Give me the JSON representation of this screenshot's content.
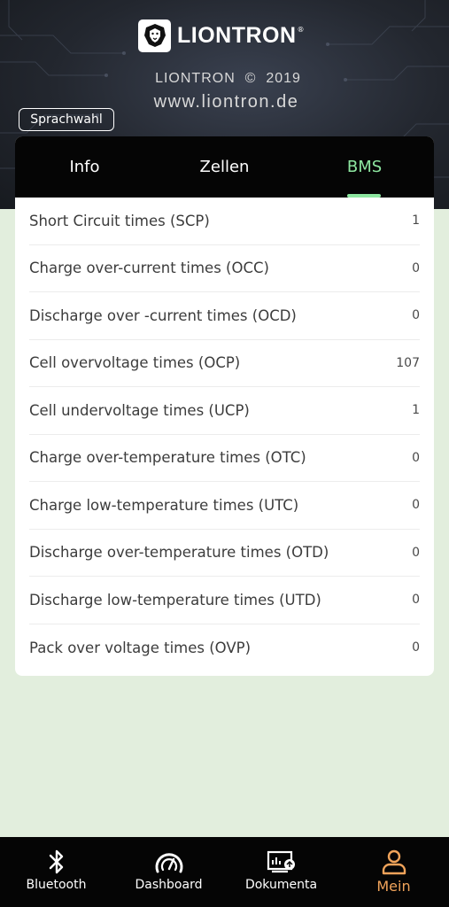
{
  "brand": {
    "name": "LIONTRON",
    "registered_mark": "®",
    "copyright": "LIONTRON  ©  2019",
    "website": "www.liontron.de"
  },
  "language_button": {
    "label": "Sprachwahl"
  },
  "tabs": [
    {
      "label": "Info",
      "active": false
    },
    {
      "label": "Zellen",
      "active": false
    },
    {
      "label": "BMS",
      "active": true
    }
  ],
  "bms_rows": [
    {
      "label": "Short Circuit times  (SCP)",
      "value": "1"
    },
    {
      "label": "Charge over-current times  (OCC)",
      "value": "0"
    },
    {
      "label": "Discharge over -current times  (OCD)",
      "value": "0"
    },
    {
      "label": "Cell overvoltage times  (OCP)",
      "value": "107"
    },
    {
      "label": "Cell undervoltage times  (UCP)",
      "value": "1"
    },
    {
      "label": "Charge over-temperature times  (OTC)",
      "value": "0"
    },
    {
      "label": "Charge low-temperature times  (UTC)",
      "value": "0"
    },
    {
      "label": "Discharge over-temperature times  (OTD)",
      "value": "0"
    },
    {
      "label": "Discharge low-temperature times  (UTD)",
      "value": "0"
    },
    {
      "label": "Pack over voltage times  (OVP)",
      "value": "0"
    }
  ],
  "bottom_nav": [
    {
      "label": "Bluetooth",
      "icon": "bluetooth-icon",
      "active": false
    },
    {
      "label": "Dashboard",
      "icon": "gauge-icon",
      "active": false
    },
    {
      "label": "Dokumenta",
      "icon": "documents-icon",
      "active": false
    },
    {
      "label": "Mein",
      "icon": "person-icon",
      "active": true
    }
  ],
  "colors": {
    "page_background": "#e2eedd",
    "active_tab": "#8de6a0",
    "active_nav": "#f0a35a",
    "bar_background": "#050505"
  }
}
